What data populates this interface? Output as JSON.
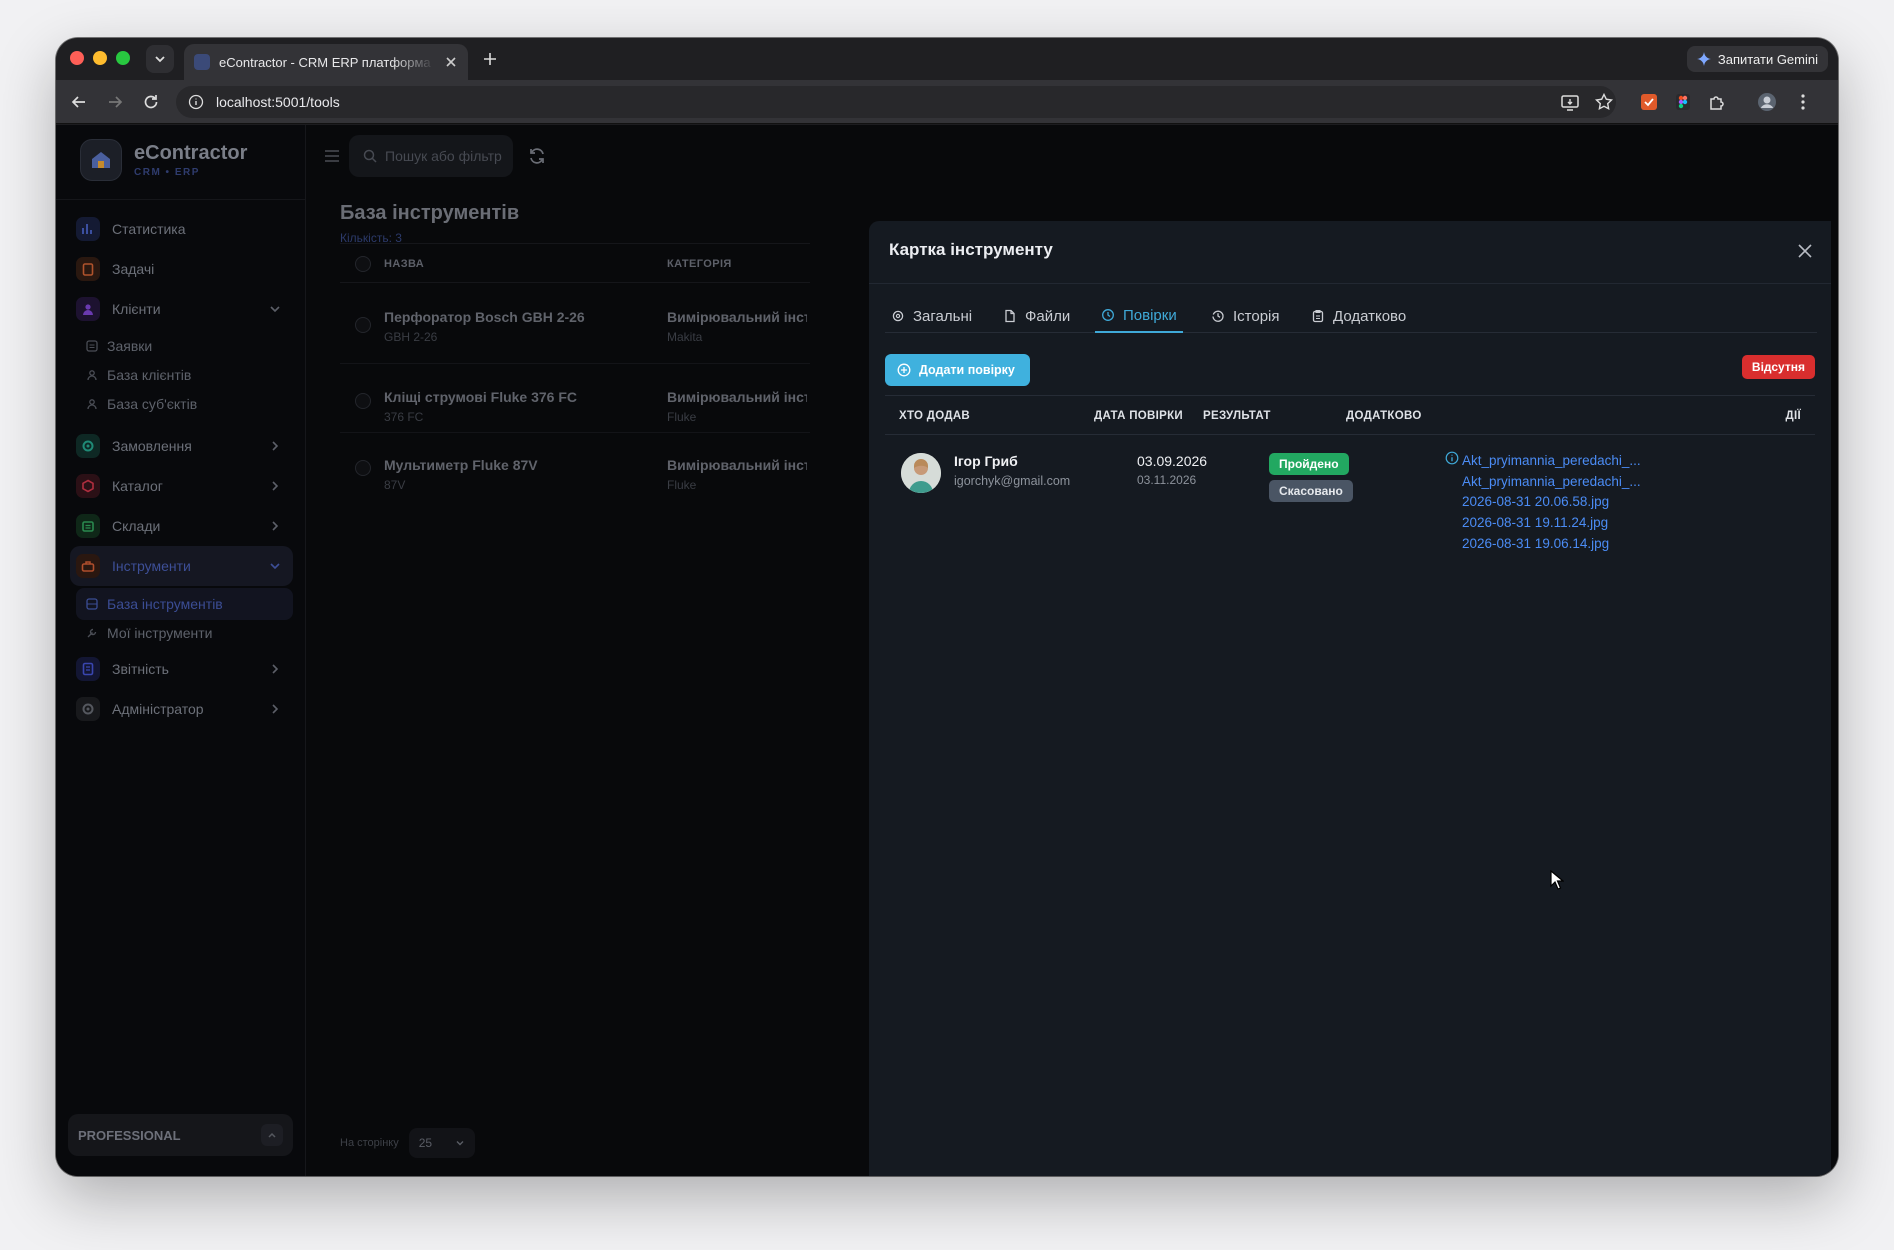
{
  "browser": {
    "tab_title": "eContractor - CRM ERP платформа",
    "url": "localhost:5001/tools",
    "gemini_label": "Запитати Gemini"
  },
  "brand": {
    "name": "eContractor",
    "subtitle": "CRM • ERP"
  },
  "sidebar": {
    "items": [
      {
        "label": "Статистика",
        "icon": "chart-icon",
        "color": "#3b4fa0"
      },
      {
        "label": "Задачі",
        "icon": "clipboard-icon",
        "color": "#b0532c"
      },
      {
        "label": "Клієнти",
        "icon": "users-icon",
        "color": "#6a3ab0"
      },
      {
        "label": "Замовлення",
        "icon": "gear-icon",
        "color": "#1f8a76"
      },
      {
        "label": "Каталог",
        "icon": "cube-icon",
        "color": "#b02e3f"
      },
      {
        "label": "Склади",
        "icon": "warehouse-icon",
        "color": "#2a8a4f"
      },
      {
        "label": "Інструменти",
        "icon": "toolbox-icon",
        "color": "#b04e2c"
      },
      {
        "label": "Звітність",
        "icon": "report-icon",
        "color": "#3a46b0"
      },
      {
        "label": "Адміністратор",
        "icon": "admin-gear-icon",
        "color": "#55585f"
      }
    ],
    "clients_sub": [
      "Заявки",
      "База клієнтів",
      "База суб'єктів"
    ],
    "tools_sub": [
      "База інструментів",
      "Мої інструменти"
    ],
    "plan": "PROFESSIONAL"
  },
  "main": {
    "search_placeholder": "Пошук або фільтр",
    "title": "База інструментів",
    "count": "Кількість: 3",
    "col_name": "НАЗВА",
    "col_category": "КАТЕГОРІЯ",
    "rows": [
      {
        "name": "Перфоратор Bosch GBH 2-26",
        "sub": "GBH 2-26",
        "category": "Вимірювальний інструмент",
        "brand": "Makita"
      },
      {
        "name": "Кліщі струмові Fluke 376 FC",
        "sub": "376 FC",
        "category": "Вимірювальний інструмент",
        "brand": "Fluke"
      },
      {
        "name": "Мультиметр Fluke 87V",
        "sub": "87V",
        "category": "Вимірювальний інструмент",
        "brand": "Fluke"
      }
    ],
    "per_page_label": "На сторінку",
    "per_page_value": "25"
  },
  "drawer": {
    "title": "Картка інструменту",
    "tabs": [
      "Загальні",
      "Файли",
      "Повірки",
      "Історія",
      "Додатково"
    ],
    "active_tab": "Повірки",
    "add_button": "Додати повірку",
    "status_badge": "Відсутня",
    "columns": [
      "ХТО ДОДАВ",
      "ДАТА ПОВІРКИ",
      "РЕЗУЛЬТАТ",
      "ДОДАТКОВО",
      "ДІЇ"
    ],
    "verification": {
      "user_name": "Ігор Гриб",
      "user_email": "igorchyk@gmail.com",
      "date": "03.09.2026",
      "date_next": "03.11.2026",
      "result_passed": "Пройдено",
      "result_cancelled": "Скасовано",
      "files": [
        "Akt_pryimannia_peredachi_...",
        "Akt_pryimannia_peredachi_...",
        "2026-08-31 20.06.58.jpg",
        "2026-08-31 19.11.24.jpg",
        "2026-08-31 19.06.14.jpg"
      ]
    }
  },
  "colors": {
    "accent": "#3fb1de",
    "passed": "#22a861",
    "cancelled": "#4a5564",
    "absent": "#d92e2e",
    "link": "#4b8cf5"
  }
}
